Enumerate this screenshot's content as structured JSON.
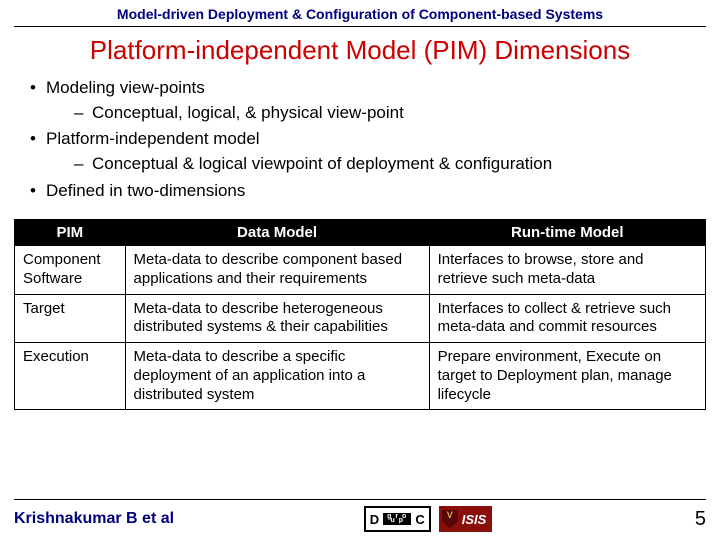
{
  "header": "Model-driven Deployment & Configuration of Component-based Systems",
  "title": "Platform-independent Model (PIM) Dimensions",
  "bullets": [
    {
      "text": "Modeling view-points",
      "sub": [
        "Conceptual, logical, & physical view-point"
      ]
    },
    {
      "text": "Platform-independent model",
      "sub": [
        "Conceptual & logical viewpoint of deployment & configuration"
      ]
    },
    {
      "text": "Defined in two-dimensions",
      "sub": []
    }
  ],
  "table": {
    "headers": {
      "pim": "PIM",
      "data_model": "Data Model",
      "runtime_model": "Run-time Model"
    },
    "rows": [
      {
        "label": "Component Software",
        "data_model": "Meta-data to describe component based applications and their requirements",
        "runtime_model": "Interfaces to browse, store and retrieve such meta-data"
      },
      {
        "label": "Target",
        "data_model": "Meta-data to describe heterogeneous distributed systems & their capabilities",
        "runtime_model": "Interfaces to collect & retrieve such meta-data and commit resources"
      },
      {
        "label": "Execution",
        "data_model": "Meta-data to describe a specific deployment of an application into a distributed system",
        "runtime_model": "Prepare environment, Execute on target to Deployment plan, manage lifecycle"
      }
    ]
  },
  "footer": {
    "author": "Krishnakumar B et al",
    "page": "5",
    "logo_doc": {
      "d": "D",
      "c": "C",
      "mid_top": "g r o",
      "mid_bot": "u p"
    },
    "logo_isis": "ISIS"
  }
}
